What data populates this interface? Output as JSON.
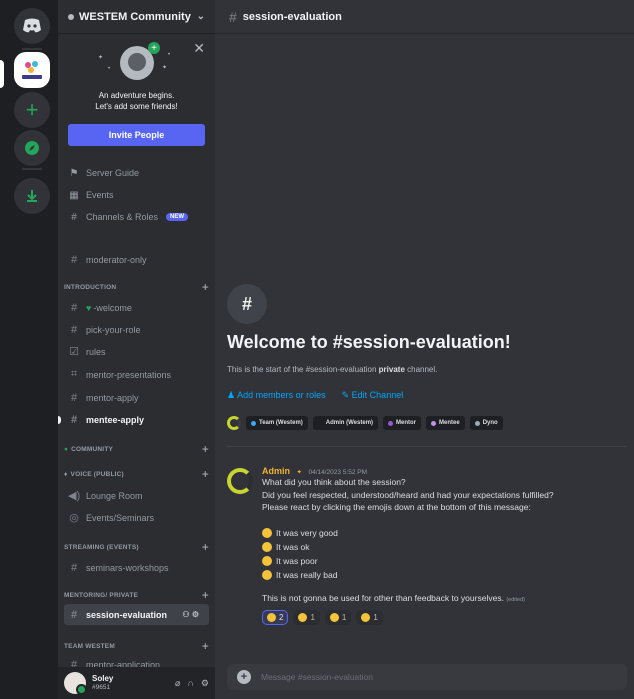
{
  "server": {
    "name": "WESTEM Community",
    "icon_label": "WESTEM"
  },
  "invite": {
    "line1": "An adventure begins.",
    "line2": "Let's add some friends!",
    "button": "Invite People"
  },
  "nav": [
    {
      "label": "Server Guide",
      "icon": "server-guide-icon"
    },
    {
      "label": "Events",
      "icon": "calendar-icon"
    },
    {
      "label": "Channels & Roles",
      "icon": "channels-roles-icon",
      "badge": "NEW"
    }
  ],
  "channels": {
    "moderator_only": "moderator-only",
    "cat_intro": "INTRODUCTION",
    "welcome": "-welcome",
    "pick_role": "pick-your-role",
    "rules": "rules",
    "mentor_presentations": "mentor-presentations",
    "mentor_apply": "mentor-apply",
    "mentee_apply": "mentee-apply",
    "cat_community": "COMMUNITY",
    "cat_voice": "VOICE (PUBLIC)",
    "lounge": "Lounge Room",
    "events_seminars": "Events/Seminars",
    "cat_streaming": "STREAMING (EVENTS)",
    "seminars_workshops": "seminars-workshops",
    "cat_mentoring": "MENTORING/ PRIVATE",
    "session_evaluation": "session-evaluation",
    "cat_team": "TEAM WESTEM",
    "mentor_application": "mentor-application"
  },
  "user": {
    "name": "Soley",
    "tag": "#9651"
  },
  "header": {
    "channel": "session-evaluation"
  },
  "welcome": {
    "title": "Welcome to #session-evaluation!",
    "sub_prefix": "This is the start of the #session-evaluation",
    "sub_bold": "private",
    "sub_suffix": "channel.",
    "add_members": "Add members or roles",
    "edit_channel": "Edit Channel"
  },
  "roles": [
    {
      "name": "Team (Westem)",
      "color": "#3ba7f5"
    },
    {
      "name": "Admin (Westem)",
      "color": "#1e1f22"
    },
    {
      "name": "Mentor",
      "color": "#9b59d0"
    },
    {
      "name": "Mentee",
      "color": "#c28ef0"
    },
    {
      "name": "Dyno",
      "color": "#99aab5"
    }
  ],
  "message": {
    "author": "Admin",
    "timestamp": "04/14/2023 5:52 PM",
    "line1": "What did you think about the session?",
    "line2": "Did you feel respected, understood/heard and had your expectations fulfilled?",
    "line3": "Please react by clicking the emojis down at the bottom of this message:",
    "options": [
      "It was very good",
      "It was ok",
      "It was poor",
      "It was really bad"
    ],
    "footer": "This is not gonna be used for other than feedback to yourselves.",
    "edited": "(edited)",
    "reactions": [
      {
        "count": "2",
        "me": true
      },
      {
        "count": "1",
        "me": false
      },
      {
        "count": "1",
        "me": false
      },
      {
        "count": "1",
        "me": false
      }
    ]
  },
  "composer": {
    "placeholder": "Message #session-evaluation"
  },
  "colors": {
    "accent": "#5865f2",
    "author": "#f0b232",
    "link": "#00a8fc",
    "welcome_heart": "#23a55a"
  }
}
